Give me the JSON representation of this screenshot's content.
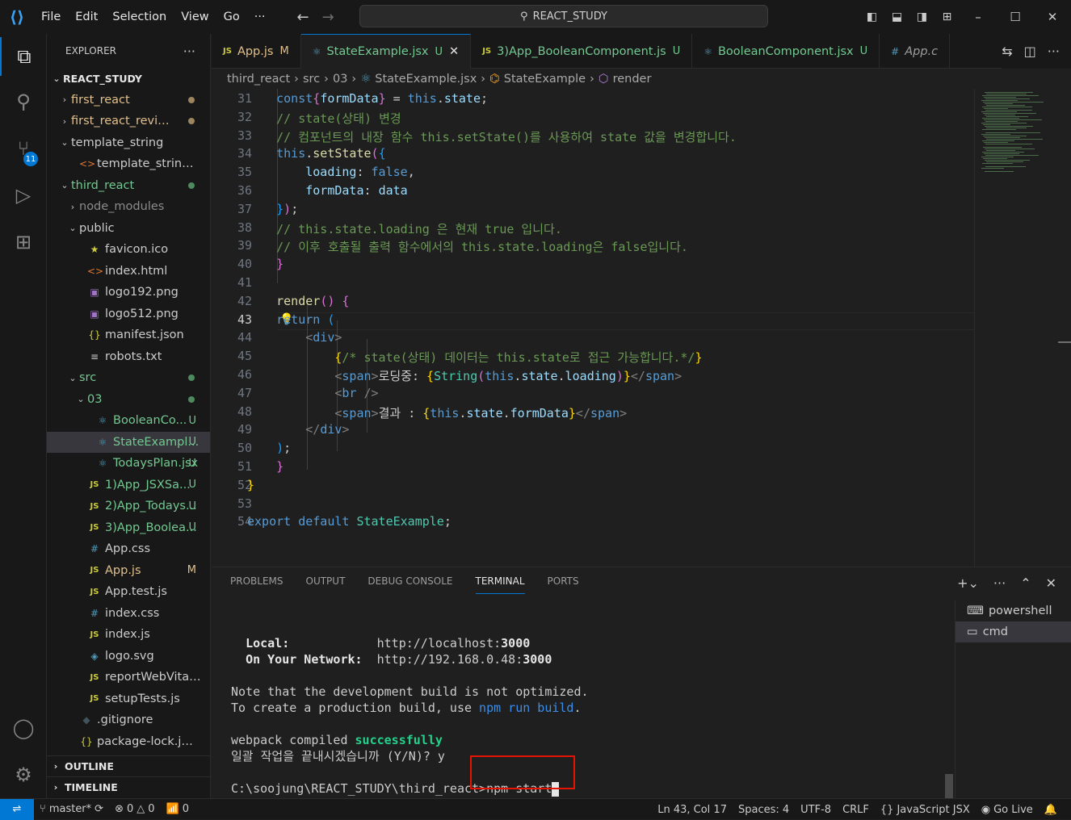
{
  "titlebar": {
    "menu": [
      "File",
      "Edit",
      "Selection",
      "View",
      "Go",
      "···"
    ],
    "search": "REACT_STUDY"
  },
  "explorer": {
    "title": "EXPLORER",
    "more": "···",
    "root": "REACT_STUDY",
    "items": [
      {
        "label": "first_react",
        "chev": "›",
        "ic": "",
        "status": "dot",
        "indent": 1,
        "color": "#e2c08d"
      },
      {
        "label": "first_react_review",
        "chev": "›",
        "ic": "",
        "status": "dot",
        "indent": 1,
        "color": "#e2c08d"
      },
      {
        "label": "template_string",
        "chev": "⌄",
        "ic": "",
        "status": "",
        "indent": 1,
        "color": "#cccccc"
      },
      {
        "label": "template_string.html",
        "chev": "",
        "ic": "<>",
        "icClass": "ic-html",
        "status": "",
        "indent": 2,
        "color": "#cccccc"
      },
      {
        "label": "third_react",
        "chev": "⌄",
        "ic": "",
        "status": "gdot",
        "indent": 1,
        "color": "#73c991"
      },
      {
        "label": "node_modules",
        "chev": "›",
        "ic": "",
        "status": "",
        "indent": 2,
        "color": "#8c8c8c"
      },
      {
        "label": "public",
        "chev": "⌄",
        "ic": "",
        "status": "",
        "indent": 2,
        "color": "#cccccc"
      },
      {
        "label": "favicon.ico",
        "chev": "",
        "ic": "★",
        "icClass": "ic-star",
        "status": "",
        "indent": 3,
        "color": "#cccccc"
      },
      {
        "label": "index.html",
        "chev": "",
        "ic": "<>",
        "icClass": "ic-html",
        "status": "",
        "indent": 3,
        "color": "#cccccc"
      },
      {
        "label": "logo192.png",
        "chev": "",
        "ic": "▣",
        "icClass": "ic-img",
        "status": "",
        "indent": 3,
        "color": "#cccccc"
      },
      {
        "label": "logo512.png",
        "chev": "",
        "ic": "▣",
        "icClass": "ic-img",
        "status": "",
        "indent": 3,
        "color": "#cccccc"
      },
      {
        "label": "manifest.json",
        "chev": "",
        "ic": "{}",
        "icClass": "ic-json",
        "status": "",
        "indent": 3,
        "color": "#cccccc"
      },
      {
        "label": "robots.txt",
        "chev": "",
        "ic": "≡",
        "icClass": "",
        "status": "",
        "indent": 3,
        "color": "#cccccc"
      },
      {
        "label": "src",
        "chev": "⌄",
        "ic": "",
        "status": "gdot",
        "indent": 2,
        "color": "#73c991"
      },
      {
        "label": "03",
        "chev": "⌄",
        "ic": "",
        "status": "gdot",
        "indent": 3,
        "color": "#73c991"
      },
      {
        "label": "BooleanCo...",
        "chev": "",
        "ic": "⚛",
        "icClass": "ic-react",
        "status": "U",
        "indent": 4,
        "color": "#73c991"
      },
      {
        "label": "StateExampl...",
        "chev": "",
        "ic": "⚛",
        "icClass": "ic-react",
        "status": "U",
        "indent": 4,
        "color": "#73c991",
        "selected": true
      },
      {
        "label": "TodaysPlan.jsx",
        "chev": "",
        "ic": "⚛",
        "icClass": "ic-react",
        "status": "U",
        "indent": 4,
        "color": "#73c991"
      },
      {
        "label": "1)App_JSXSa...",
        "chev": "",
        "ic": "JS",
        "icClass": "ic-js",
        "status": "U",
        "indent": 3,
        "color": "#73c991"
      },
      {
        "label": "2)App_Todays...",
        "chev": "",
        "ic": "JS",
        "icClass": "ic-js",
        "status": "U",
        "indent": 3,
        "color": "#73c991"
      },
      {
        "label": "3)App_Boolea...",
        "chev": "",
        "ic": "JS",
        "icClass": "ic-js",
        "status": "U",
        "indent": 3,
        "color": "#73c991"
      },
      {
        "label": "App.css",
        "chev": "",
        "ic": "#",
        "icClass": "ic-css",
        "status": "",
        "indent": 3,
        "color": "#cccccc"
      },
      {
        "label": "App.js",
        "chev": "",
        "ic": "JS",
        "icClass": "ic-js",
        "status": "M",
        "indent": 3,
        "color": "#e2c08d"
      },
      {
        "label": "App.test.js",
        "chev": "",
        "ic": "JS",
        "icClass": "ic-js",
        "status": "",
        "indent": 3,
        "color": "#cccccc"
      },
      {
        "label": "index.css",
        "chev": "",
        "ic": "#",
        "icClass": "ic-css",
        "status": "",
        "indent": 3,
        "color": "#cccccc"
      },
      {
        "label": "index.js",
        "chev": "",
        "ic": "JS",
        "icClass": "ic-js",
        "status": "",
        "indent": 3,
        "color": "#cccccc"
      },
      {
        "label": "logo.svg",
        "chev": "",
        "ic": "◈",
        "icClass": "ic-css",
        "status": "",
        "indent": 3,
        "color": "#cccccc"
      },
      {
        "label": "reportWebVitals.js",
        "chev": "",
        "ic": "JS",
        "icClass": "ic-js",
        "status": "",
        "indent": 3,
        "color": "#cccccc"
      },
      {
        "label": "setupTests.js",
        "chev": "",
        "ic": "JS",
        "icClass": "ic-js",
        "status": "",
        "indent": 3,
        "color": "#cccccc"
      },
      {
        "label": ".gitignore",
        "chev": "",
        "ic": "◆",
        "icClass": "ic-git",
        "status": "",
        "indent": 2,
        "color": "#cccccc"
      },
      {
        "label": "package-lock.json",
        "chev": "",
        "ic": "{}",
        "icClass": "ic-json",
        "status": "",
        "indent": 2,
        "color": "#cccccc"
      }
    ],
    "outline": "OUTLINE",
    "timeline": "TIMELINE"
  },
  "tabs": [
    {
      "icon": "JS",
      "label": "App.js",
      "status": "M",
      "statusColor": "#e2c08d",
      "labelColor": "#e2c08d"
    },
    {
      "icon": "⚛",
      "label": "StateExample.jsx",
      "status": "U",
      "statusColor": "#73c991",
      "labelColor": "#73c991",
      "active": true,
      "close": "✕"
    },
    {
      "icon": "JS",
      "label": "3)App_BooleanComponent.js",
      "status": "U",
      "statusColor": "#73c991",
      "labelColor": "#73c991"
    },
    {
      "icon": "⚛",
      "label": "BooleanComponent.jsx",
      "status": "U",
      "statusColor": "#73c991",
      "labelColor": "#73c991"
    },
    {
      "icon": "#",
      "label": "App.c",
      "status": "",
      "statusColor": "",
      "labelColor": "#9d9d9d"
    }
  ],
  "breadcrumb": [
    "third_react",
    "src",
    "03",
    "StateExample.jsx",
    "StateExample",
    "render"
  ],
  "editor": {
    "current_line": 43,
    "lines": [
      {
        "n": 31,
        "html": "        <span class='k'>const</span><span class='br2'>{</span><span class='v'>formData</span><span class='br2'>}</span> = <span class='k'>this</span>.<span class='v'>state</span>;"
      },
      {
        "n": 32,
        "html": "        <span class='c'>// state(상태) 변경</span>"
      },
      {
        "n": 33,
        "html": "        <span class='c'>// 컴포넌트의 내장 함수 this.setState()를 사용하여 state 값을 변경합니다.</span>"
      },
      {
        "n": 34,
        "html": "        <span class='k'>this</span>.<span class='f'>setState</span><span class='br2'>(</span><span class='br3'>{</span>"
      },
      {
        "n": 35,
        "html": "            <span class='v'>loading</span>: <span class='k'>false</span>,"
      },
      {
        "n": 36,
        "html": "            <span class='v'>formData</span>: <span class='v'>data</span>"
      },
      {
        "n": 37,
        "html": "        <span class='br3'>}</span><span class='br2'>)</span>;"
      },
      {
        "n": 38,
        "html": "        <span class='c'>// this.state.loading 은 현재 true 입니다.</span>"
      },
      {
        "n": 39,
        "html": "        <span class='c'>// 이후 호출될 출력 함수에서의 this.state.loading은 false입니다.</span>"
      },
      {
        "n": 40,
        "html": "    <span class='br2'>}</span>"
      },
      {
        "n": 41,
        "html": ""
      },
      {
        "n": 42,
        "html": "    <span class='f'>render</span><span class='br2'>()</span> <span class='br2'>{</span>"
      },
      {
        "n": 43,
        "html": "        <span class='k'>return</span> <span class='br3'>(</span>"
      },
      {
        "n": 44,
        "html": "            <span class='tag'>&lt;</span><span class='tg'>div</span><span class='tag'>&gt;</span>"
      },
      {
        "n": 45,
        "html": "                <span class='br1'>{</span><span class='c'>/* state(상태) 데이터는 this.state로 접근 가능합니다.*/</span><span class='br1'>}</span>"
      },
      {
        "n": 46,
        "html": "                <span class='tag'>&lt;</span><span class='tg'>span</span><span class='tag'>&gt;</span>로딩중: <span class='br1'>{</span><span class='t'>String</span><span class='br2'>(</span><span class='k'>this</span>.<span class='v'>state</span>.<span class='v'>loading</span><span class='br2'>)</span><span class='br1'>}</span><span class='tag'>&lt;/</span><span class='tg'>span</span><span class='tag'>&gt;</span>"
      },
      {
        "n": 47,
        "html": "                <span class='tag'>&lt;</span><span class='tg'>br</span> <span class='tag'>/&gt;</span>"
      },
      {
        "n": 48,
        "html": "                <span class='tag'>&lt;</span><span class='tg'>span</span><span class='tag'>&gt;</span>결과 : <span class='br1'>{</span><span class='k'>this</span>.<span class='v'>state</span>.<span class='v'>formData</span><span class='br1'>}</span><span class='tag'>&lt;/</span><span class='tg'>span</span><span class='tag'>&gt;</span>"
      },
      {
        "n": 49,
        "html": "            <span class='tag'>&lt;/</span><span class='tg'>div</span><span class='tag'>&gt;</span>"
      },
      {
        "n": 50,
        "html": "        <span class='br3'>)</span>;"
      },
      {
        "n": 51,
        "html": "    <span class='br2'>}</span>"
      },
      {
        "n": 52,
        "html": "<span class='br1'>}</span>"
      },
      {
        "n": 53,
        "html": ""
      },
      {
        "n": 54,
        "html": "<span class='k'>export</span> <span class='k'>default</span> <span class='t'>StateExample</span>;"
      }
    ]
  },
  "panel": {
    "tabs": [
      "PROBLEMS",
      "OUTPUT",
      "DEBUG CONSOLE",
      "TERMINAL",
      "PORTS"
    ],
    "active_tab": "TERMINAL",
    "terminal_lines": [
      {
        "html": ""
      },
      {
        "html": "  <span class='b'>Local:</span>            http://localhost:<span class='b'>3000</span>"
      },
      {
        "html": "  <span class='b'>On Your Network:</span>  http://192.168.0.48:<span class='b'>3000</span>"
      },
      {
        "html": ""
      },
      {
        "html": "Note that the development build is not optimized."
      },
      {
        "html": "To create a production build, use <span class='cy'>npm run build</span>."
      },
      {
        "html": ""
      },
      {
        "html": "webpack compiled <span class='gn'>successfully</span>"
      },
      {
        "html": "일괄 작업을 끝내시겠습니까 (Y/N)? y"
      },
      {
        "html": ""
      }
    ],
    "prompt": "C:\\soojung\\REACT_STUDY\\third_react>npm start",
    "terminals": [
      {
        "label": "powershell",
        "icon": "⌨"
      },
      {
        "label": "cmd",
        "icon": "▭",
        "active": true
      }
    ]
  },
  "statusbar": {
    "branch": "master*",
    "errors": "0",
    "warnings": "0",
    "ports": "0",
    "position": "Ln 43, Col 17",
    "spaces": "Spaces: 4",
    "encoding": "UTF-8",
    "eol": "CRLF",
    "language": "JavaScript JSX",
    "golive": "Go Live"
  }
}
